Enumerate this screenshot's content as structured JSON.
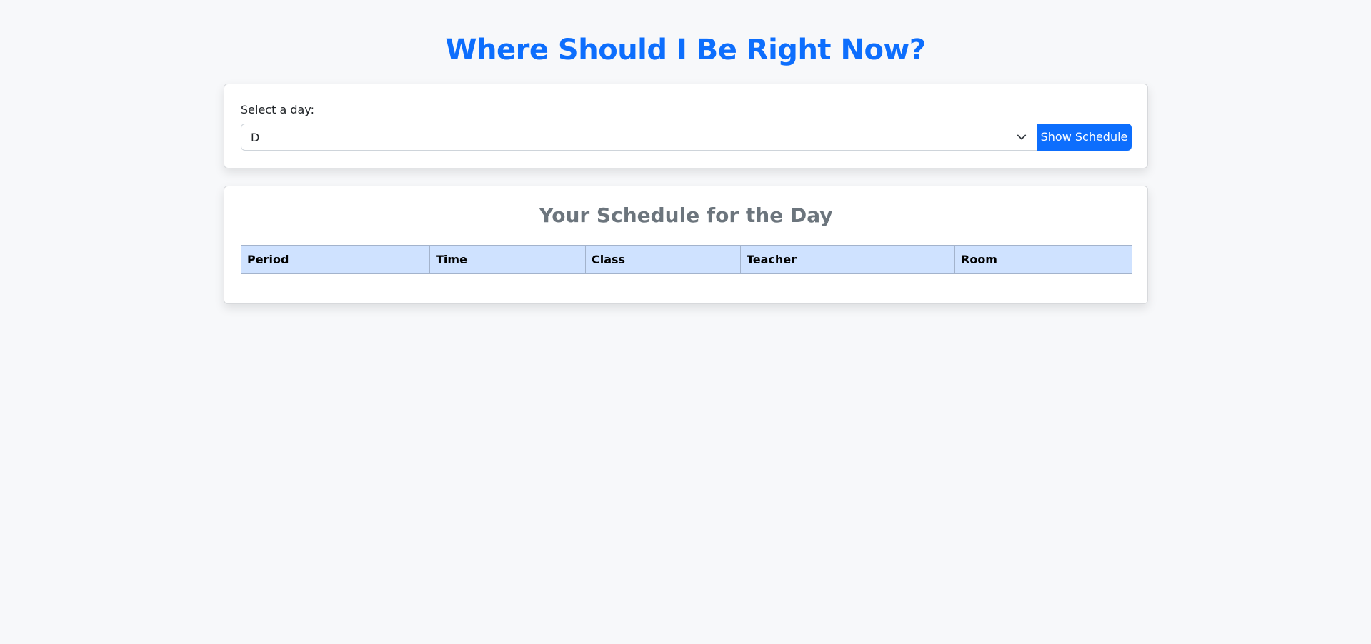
{
  "page": {
    "title": "Where Should I Be Right Now?"
  },
  "day_selector": {
    "label": "Select a day:",
    "selected_value": "D",
    "button_label": "Show Schedule"
  },
  "schedule": {
    "title": "Your Schedule for the Day",
    "columns": [
      "Period",
      "Time",
      "Class",
      "Teacher",
      "Room"
    ],
    "rows": []
  },
  "colors": {
    "accent": "#0d6efd",
    "header_bg": "#cfe2ff",
    "muted_title": "#6c757d",
    "page_bg": "#f7f8fa"
  },
  "icons": {
    "select_arrow": "chevron-down-icon"
  }
}
